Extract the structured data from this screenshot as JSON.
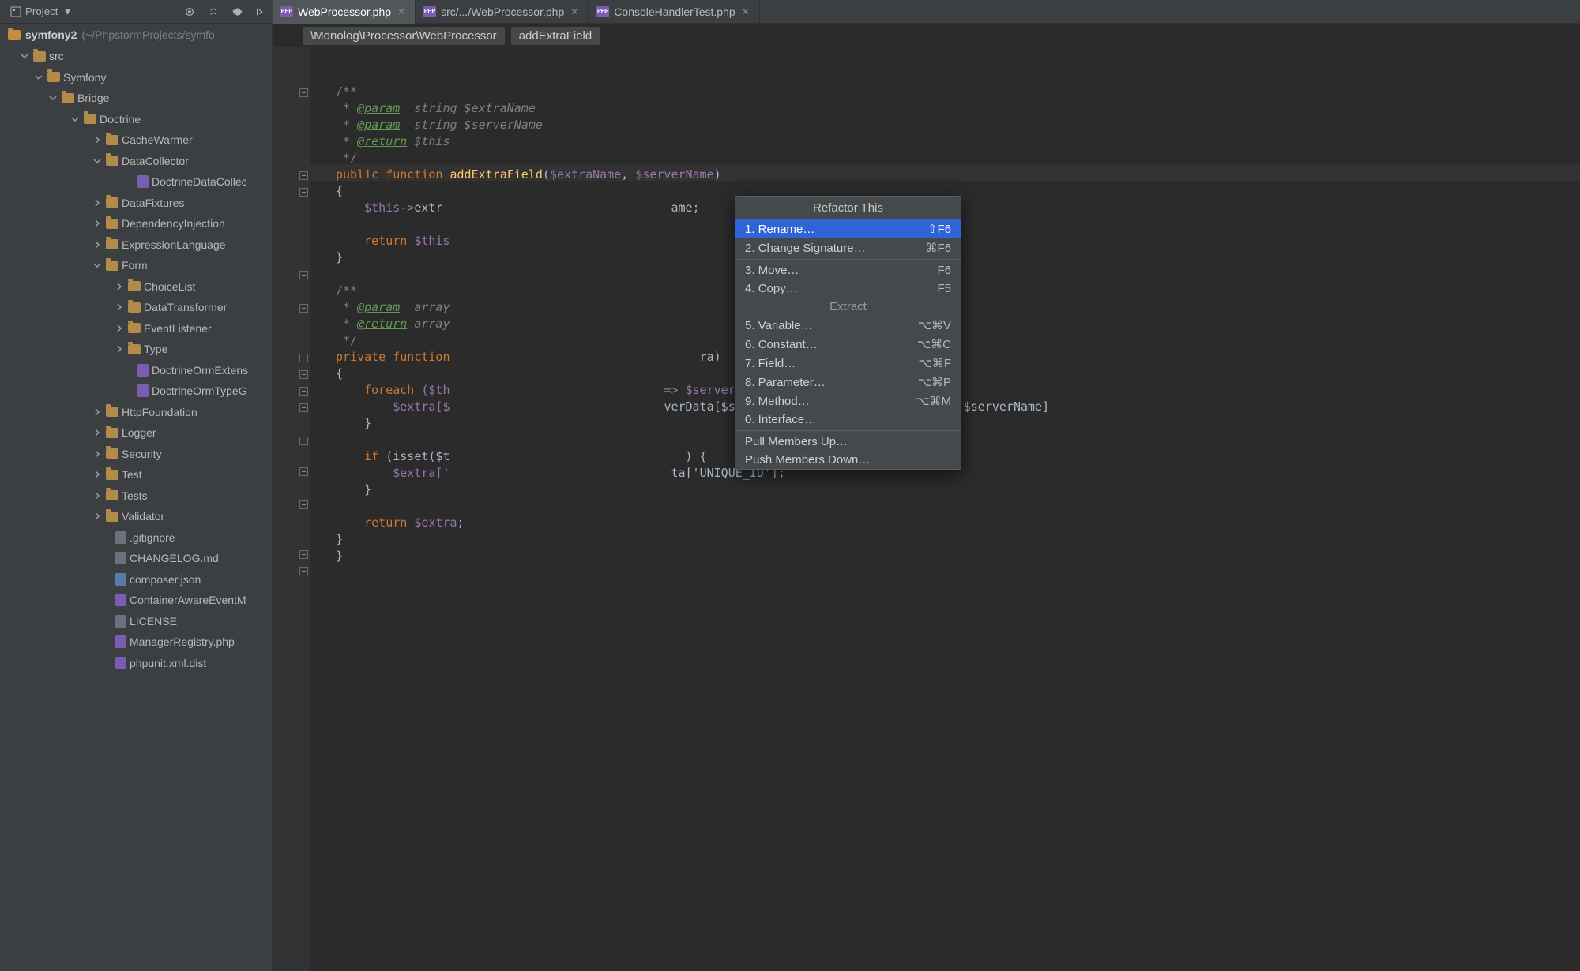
{
  "toolbar": {
    "project_label": "Project"
  },
  "tabs": [
    {
      "label": "WebProcessor.php",
      "active": true
    },
    {
      "label": "src/.../WebProcessor.php",
      "active": false
    },
    {
      "label": "ConsoleHandlerTest.php",
      "active": false
    }
  ],
  "breadcrumb": {
    "path": "\\Monolog\\Processor\\WebProcessor",
    "member": "addExtraField"
  },
  "projectRoot": {
    "name": "symfony2",
    "path": "(~/PhpstormProjects/symfo"
  },
  "tree": [
    {
      "d": 1,
      "k": "folder",
      "open": true,
      "label": "src"
    },
    {
      "d": 2,
      "k": "folder",
      "open": true,
      "label": "Symfony"
    },
    {
      "d": 3,
      "k": "folder",
      "open": true,
      "label": "Bridge"
    },
    {
      "d": 4,
      "k": "folder",
      "open": true,
      "label": "Doctrine"
    },
    {
      "d": 5,
      "k": "folder",
      "open": false,
      "label": "CacheWarmer"
    },
    {
      "d": 5,
      "k": "folder",
      "open": true,
      "label": "DataCollector"
    },
    {
      "d": 6,
      "k": "file",
      "ft": "php",
      "label": "DoctrineDataCollec"
    },
    {
      "d": 5,
      "k": "folder",
      "open": false,
      "label": "DataFixtures"
    },
    {
      "d": 5,
      "k": "folder",
      "open": false,
      "label": "DependencyInjection"
    },
    {
      "d": 5,
      "k": "folder",
      "open": false,
      "label": "ExpressionLanguage"
    },
    {
      "d": 5,
      "k": "folder",
      "open": true,
      "label": "Form"
    },
    {
      "d": 6,
      "k": "folder",
      "open": false,
      "label": "ChoiceList"
    },
    {
      "d": 6,
      "k": "folder",
      "open": false,
      "label": "DataTransformer"
    },
    {
      "d": 6,
      "k": "folder",
      "open": false,
      "label": "EventListener"
    },
    {
      "d": 6,
      "k": "folder",
      "open": false,
      "label": "Type"
    },
    {
      "d": 6,
      "k": "file",
      "ft": "php",
      "label": "DoctrineOrmExtens"
    },
    {
      "d": 6,
      "k": "file",
      "ft": "php",
      "label": "DoctrineOrmTypeG"
    },
    {
      "d": 5,
      "k": "folder",
      "open": false,
      "label": "HttpFoundation"
    },
    {
      "d": 5,
      "k": "folder",
      "open": false,
      "label": "Logger"
    },
    {
      "d": 5,
      "k": "folder",
      "open": false,
      "label": "Security"
    },
    {
      "d": 5,
      "k": "folder",
      "open": false,
      "label": "Test"
    },
    {
      "d": 5,
      "k": "folder",
      "open": false,
      "label": "Tests"
    },
    {
      "d": 5,
      "k": "folder",
      "open": false,
      "label": "Validator"
    },
    {
      "d": 5,
      "k": "file",
      "ft": "txt",
      "label": ".gitignore"
    },
    {
      "d": 5,
      "k": "file",
      "ft": "txt",
      "label": "CHANGELOG.md"
    },
    {
      "d": 5,
      "k": "file",
      "ft": "json",
      "label": "composer.json"
    },
    {
      "d": 5,
      "k": "file",
      "ft": "php",
      "label": "ContainerAwareEventM"
    },
    {
      "d": 5,
      "k": "file",
      "ft": "txt",
      "label": "LICENSE"
    },
    {
      "d": 5,
      "k": "file",
      "ft": "php",
      "label": "ManagerRegistry.php"
    },
    {
      "d": 5,
      "k": "file",
      "ft": "php",
      "label": "phpunit.xml.dist"
    }
  ],
  "popup": {
    "title": "Refactor This",
    "section": "Extract",
    "items1": [
      {
        "n": "1.",
        "label": "Rename…",
        "shortcut": "⇧F6",
        "selected": true
      },
      {
        "n": "2.",
        "label": "Change Signature…",
        "shortcut": "⌘F6"
      }
    ],
    "items2": [
      {
        "n": "3.",
        "label": "Move…",
        "shortcut": "F6"
      },
      {
        "n": "4.",
        "label": "Copy…",
        "shortcut": "F5"
      }
    ],
    "items3": [
      {
        "n": "5.",
        "label": "Variable…",
        "shortcut": "⌥⌘V"
      },
      {
        "n": "6.",
        "label": "Constant…",
        "shortcut": "⌥⌘C"
      },
      {
        "n": "7.",
        "label": "Field…",
        "shortcut": "⌥⌘F"
      },
      {
        "n": "8.",
        "label": "Parameter…",
        "shortcut": "⌥⌘P"
      },
      {
        "n": "9.",
        "label": "Method…",
        "shortcut": "⌥⌘M"
      },
      {
        "n": "0.",
        "label": "Interface…",
        "shortcut": ""
      }
    ],
    "items4": [
      {
        "n": "",
        "label": "Pull Members Up…",
        "shortcut": ""
      },
      {
        "n": "",
        "label": "Push Members Down…",
        "shortcut": ""
      }
    ]
  },
  "code": {
    "doc1_open": "/**",
    "doc_star": " * ",
    "doc_param": "@param",
    "doc_return": "@return",
    "doc_extraName": "string $extraName",
    "doc_serverName": "string $serverName",
    "doc_this": "$this",
    "doc_close": " */",
    "kw_public": "public",
    "kw_private": "private",
    "kw_function": "function",
    "fn_add": "addExtraField",
    "p_open": "(",
    "p_close": ")",
    "extraName": "$extraName",
    "serverName": "$serverName",
    "brace_open": "{",
    "brace_close": "}",
    "thisArrow": "$this->",
    "extr": "extr",
    "ame": "ame;",
    "kw_return": "return",
    "dollThis": "$this",
    "semi": ";",
    "doc_array": "array",
    "kw_foreach": "foreach",
    "dollTh": "($th",
    "arrow_server": " => $serverName) {",
    "extraIdx": "$extra[$",
    "verData": "verData[$serverName]) ? $this->serverData[$serverName]",
    "kw_if": "if",
    "isset": "(isset($t",
    "close_brace_cond": ") {",
    "extra_unique": "$extra['",
    "ta_unique": "ta['UNIQUE_ID'];",
    "retExtra": "$extra",
    "ra": "ra)"
  }
}
